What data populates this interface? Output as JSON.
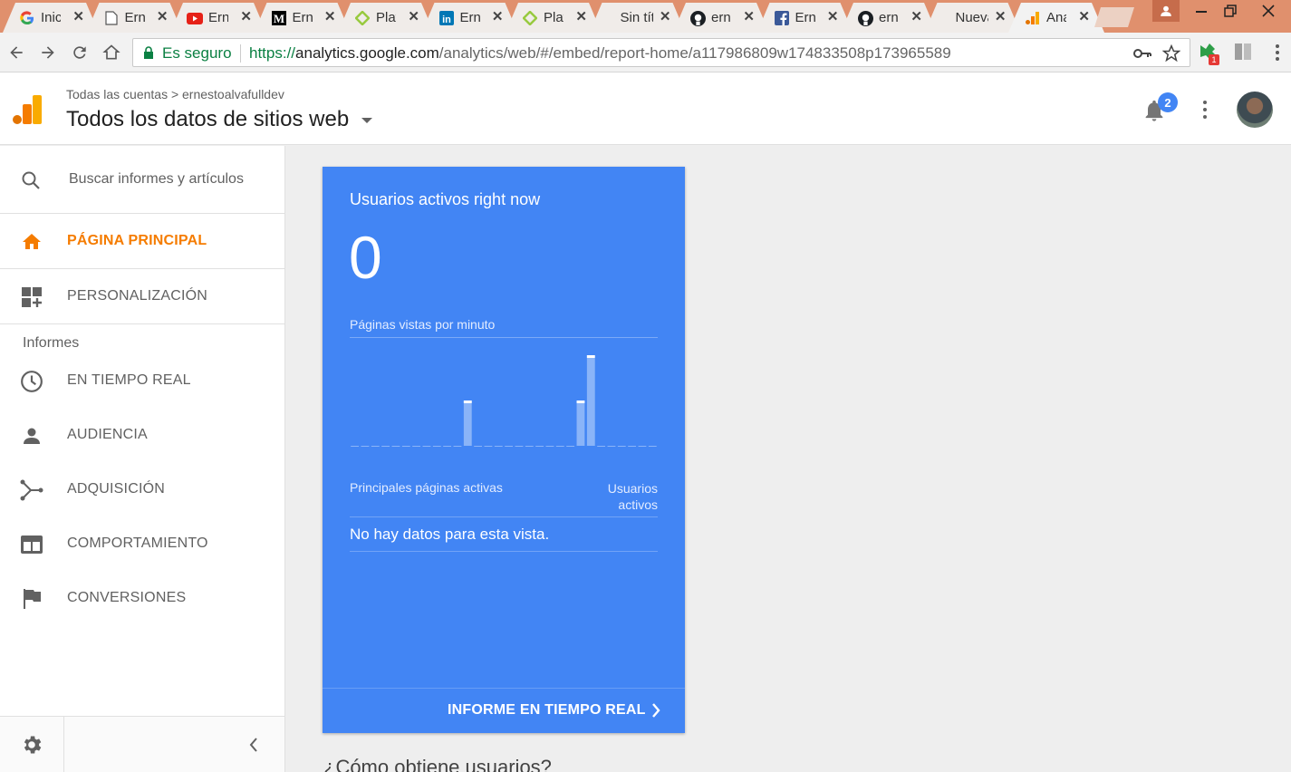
{
  "browser": {
    "tabs": [
      {
        "title": "Inicio",
        "icon": "google-g-icon"
      },
      {
        "title": "Ernesto",
        "icon": "document-icon"
      },
      {
        "title": "Ernesto",
        "icon": "youtube-icon"
      },
      {
        "title": "Ernesto",
        "icon": "medium-icon"
      },
      {
        "title": "Platzi",
        "icon": "platzi-icon"
      },
      {
        "title": "Ernesto",
        "icon": "linkedin-icon"
      },
      {
        "title": "Platzi",
        "icon": "platzi-icon"
      },
      {
        "title": "Sin título",
        "icon": ""
      },
      {
        "title": "ernesto",
        "icon": "github-icon"
      },
      {
        "title": "Ernesto",
        "icon": "facebook-icon"
      },
      {
        "title": "ernesto",
        "icon": "github-icon"
      },
      {
        "title": "Nueva pestaña",
        "icon": ""
      },
      {
        "title": "Analytics",
        "icon": "analytics-icon",
        "active": true
      }
    ],
    "secure_label": "Es seguro",
    "url_scheme": "https://",
    "url_host": "analytics.google.com",
    "url_path": "/analytics/web/#/embed/report-home/a117986809w174833508p173965589",
    "extension_badge": "1"
  },
  "header": {
    "breadcrumb": "Todas las cuentas > ernestoalvafulldev",
    "view_title": "Todos los datos de sitios web",
    "notification_count": "2"
  },
  "sidebar": {
    "search_placeholder": "Buscar informes y artículos",
    "home": "PÁGINA PRINCIPAL",
    "customization": "PERSONALIZACIÓN",
    "section_reports": "Informes",
    "items": [
      {
        "label": "EN TIEMPO REAL",
        "icon": "clock-icon"
      },
      {
        "label": "AUDIENCIA",
        "icon": "person-icon"
      },
      {
        "label": "ADQUISICIÓN",
        "icon": "acquisition-icon"
      },
      {
        "label": "COMPORTAMIENTO",
        "icon": "behavior-icon"
      },
      {
        "label": "CONVERSIONES",
        "icon": "flag-icon"
      }
    ]
  },
  "realtime": {
    "title": "Usuarios activos right now",
    "active_users": "0",
    "chart_title": "Páginas vistas por minuto",
    "table_col_pages": "Principales páginas activas",
    "table_col_users": "Usuarios activos",
    "empty_message": "No hay datos para esta vista.",
    "report_link": "INFORME EN TIEMPO REAL"
  },
  "chart_data": {
    "type": "bar",
    "title": "Páginas vistas por minuto",
    "values": [
      0,
      0,
      0,
      0,
      0,
      0,
      0,
      0,
      0,
      0,
      0,
      1,
      0,
      0,
      0,
      0,
      0,
      0,
      0,
      0,
      0,
      0,
      1,
      2,
      0,
      0,
      0,
      0,
      0,
      0
    ],
    "ylim": [
      0,
      2
    ]
  },
  "next_section": "¿Cómo obtiene usuarios?",
  "colors": {
    "card": "#4285f4",
    "accent": "#f57c00",
    "secure": "#0b8043"
  }
}
